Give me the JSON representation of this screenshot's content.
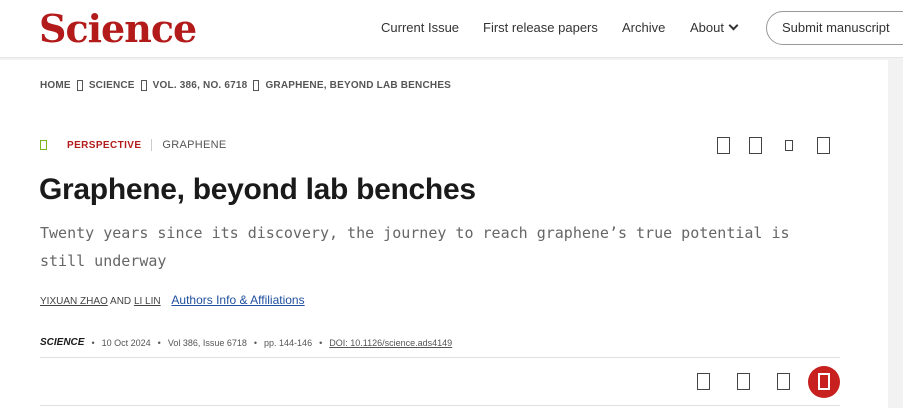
{
  "header": {
    "logo": "Science",
    "nav": [
      "Current Issue",
      "First release papers",
      "Archive",
      "About"
    ],
    "submit": "Submit manuscript"
  },
  "breadcrumb": [
    "HOME",
    "SCIENCE",
    "VOL. 386, NO. 6718",
    "GRAPHENE, BEYOND LAB BENCHES"
  ],
  "article": {
    "type": "PERSPECTIVE",
    "topic": "GRAPHENE",
    "title": "Graphene, beyond lab benches",
    "subtitle": "Twenty years since its discovery, the journey to reach graphene’s true potential is still underway",
    "author1": "YIXUAN ZHAO",
    "and": "AND",
    "author2": "LI LIN",
    "authors_link": "Authors Info & Affiliations",
    "journal": "SCIENCE",
    "date": "10 Oct 2024",
    "volume": "Vol 386, Issue 6718",
    "pages": "pp. 144-146",
    "doi": "DOI: 10.1126/science.ads4149",
    "separator": "•"
  },
  "colors": {
    "brand": "#b31b1b",
    "link": "#1f4f9e",
    "open_access": "#7ab51d"
  }
}
